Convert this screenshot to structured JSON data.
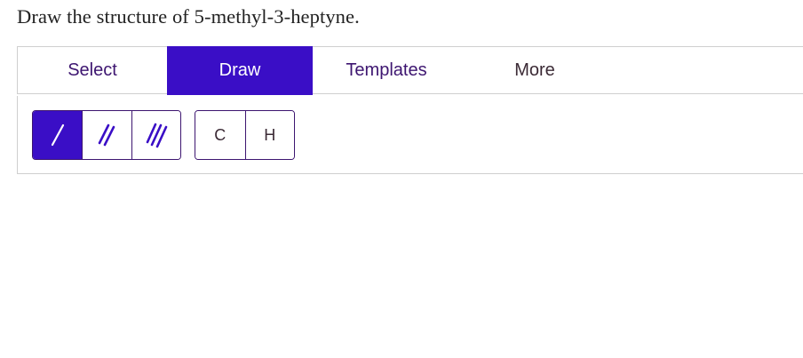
{
  "question": {
    "text": "Draw the structure of 5-methyl-3-heptyne."
  },
  "tabs": [
    {
      "label": "Select",
      "active": false
    },
    {
      "label": "Draw",
      "active": true
    },
    {
      "label": "Templates",
      "active": false
    },
    {
      "label": "More",
      "active": false
    }
  ],
  "toolbar": {
    "bonds": [
      {
        "icon": "single-bond-icon",
        "active": true
      },
      {
        "icon": "double-bond-icon",
        "active": false
      },
      {
        "icon": "triple-bond-icon",
        "active": false
      }
    ],
    "atoms": [
      {
        "label": "C"
      },
      {
        "label": "H"
      }
    ]
  },
  "colors": {
    "accent": "#3a0ec6",
    "tab_text": "#3d1570",
    "border": "#cfcfcf"
  }
}
